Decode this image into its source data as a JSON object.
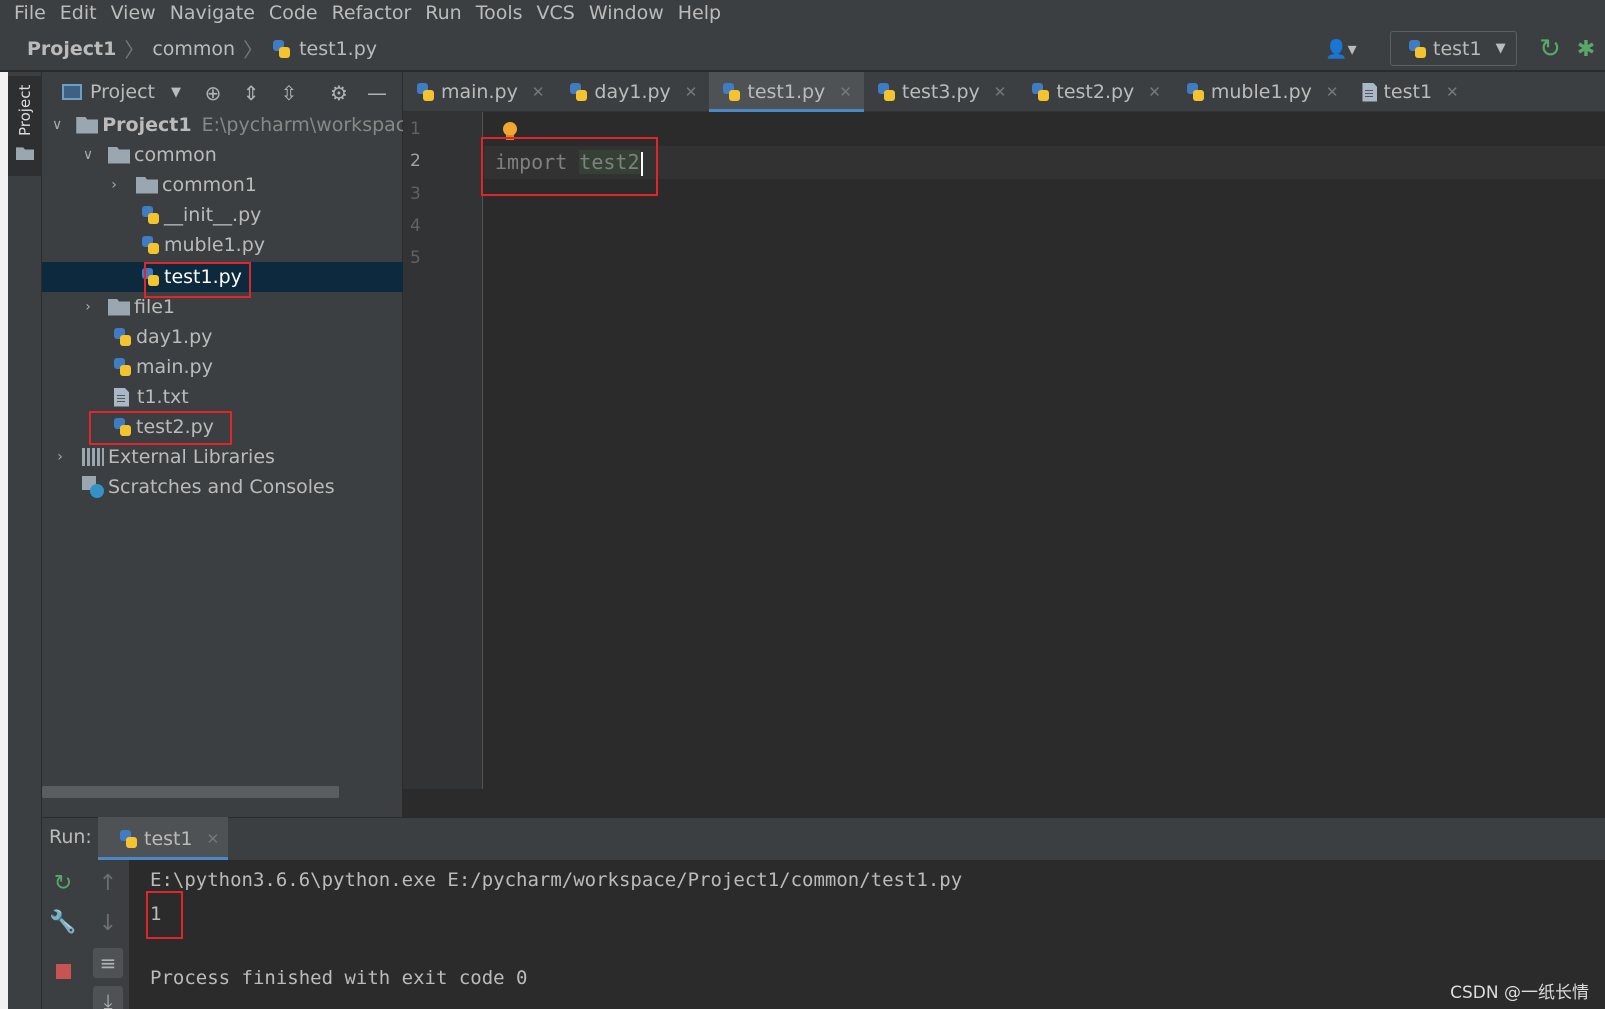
{
  "menu": [
    "File",
    "Edit",
    "View",
    "Navigate",
    "Code",
    "Refactor",
    "Run",
    "Tools",
    "VCS",
    "Window",
    "Help"
  ],
  "breadcrumb": {
    "project": "Project1",
    "folder": "common",
    "file": "test1.py"
  },
  "run_config": {
    "name": "test1"
  },
  "tool_window": {
    "label": "Project"
  },
  "project_panel": {
    "title": "Project",
    "tree": [
      {
        "label": "Project1",
        "path": "E:\\pycharm\\workspace\\P",
        "type": "folder"
      },
      {
        "label": "common",
        "type": "folder"
      },
      {
        "label": "common1",
        "type": "folder"
      },
      {
        "label": "__init__.py",
        "type": "py"
      },
      {
        "label": "muble1.py",
        "type": "py"
      },
      {
        "label": "test1.py",
        "type": "py"
      },
      {
        "label": "file1",
        "type": "folder"
      },
      {
        "label": "day1.py",
        "type": "py"
      },
      {
        "label": "main.py",
        "type": "py"
      },
      {
        "label": "t1.txt",
        "type": "txt"
      },
      {
        "label": "test2.py",
        "type": "py"
      },
      {
        "label": "External Libraries",
        "type": "lib"
      },
      {
        "label": "Scratches and Consoles",
        "type": "scratch"
      }
    ]
  },
  "tabs": [
    {
      "label": "main.py"
    },
    {
      "label": "day1.py"
    },
    {
      "label": "test1.py"
    },
    {
      "label": "test3.py"
    },
    {
      "label": "test2.py"
    },
    {
      "label": "muble1.py"
    },
    {
      "label": "test1"
    }
  ],
  "editor": {
    "line_numbers": [
      "1",
      "2",
      "3",
      "4",
      "5"
    ],
    "code_keyword": "import ",
    "code_module": "test2"
  },
  "run_panel": {
    "label": "Run:",
    "tab": "test1",
    "console": {
      "command": "E:\\python3.6.6\\python.exe E:/pycharm/workspace/Project1/common/test1.py",
      "output": "1",
      "finish": "Process finished with exit code 0"
    }
  },
  "watermark": "CSDN @一纸长情",
  "colors": {
    "accent": "#4a88c7",
    "highlight_box": "#e0262b",
    "selection": "#0d293e",
    "run_green": "#59a869",
    "stop_red": "#c75450"
  },
  "icons": [
    "user-icon",
    "python-icon",
    "rerun-icon",
    "debug-icon",
    "locate-icon",
    "expand-all-icon",
    "collapse-all-icon",
    "gear-icon",
    "minimize-icon",
    "folder-icon",
    "file-icon",
    "library-icon",
    "scratch-icon",
    "lightbulb-icon",
    "wrench-icon",
    "stop-icon",
    "arrow-up-icon",
    "arrow-down-icon",
    "soft-wrap-icon",
    "scroll-to-end-icon",
    "close-icon"
  ]
}
